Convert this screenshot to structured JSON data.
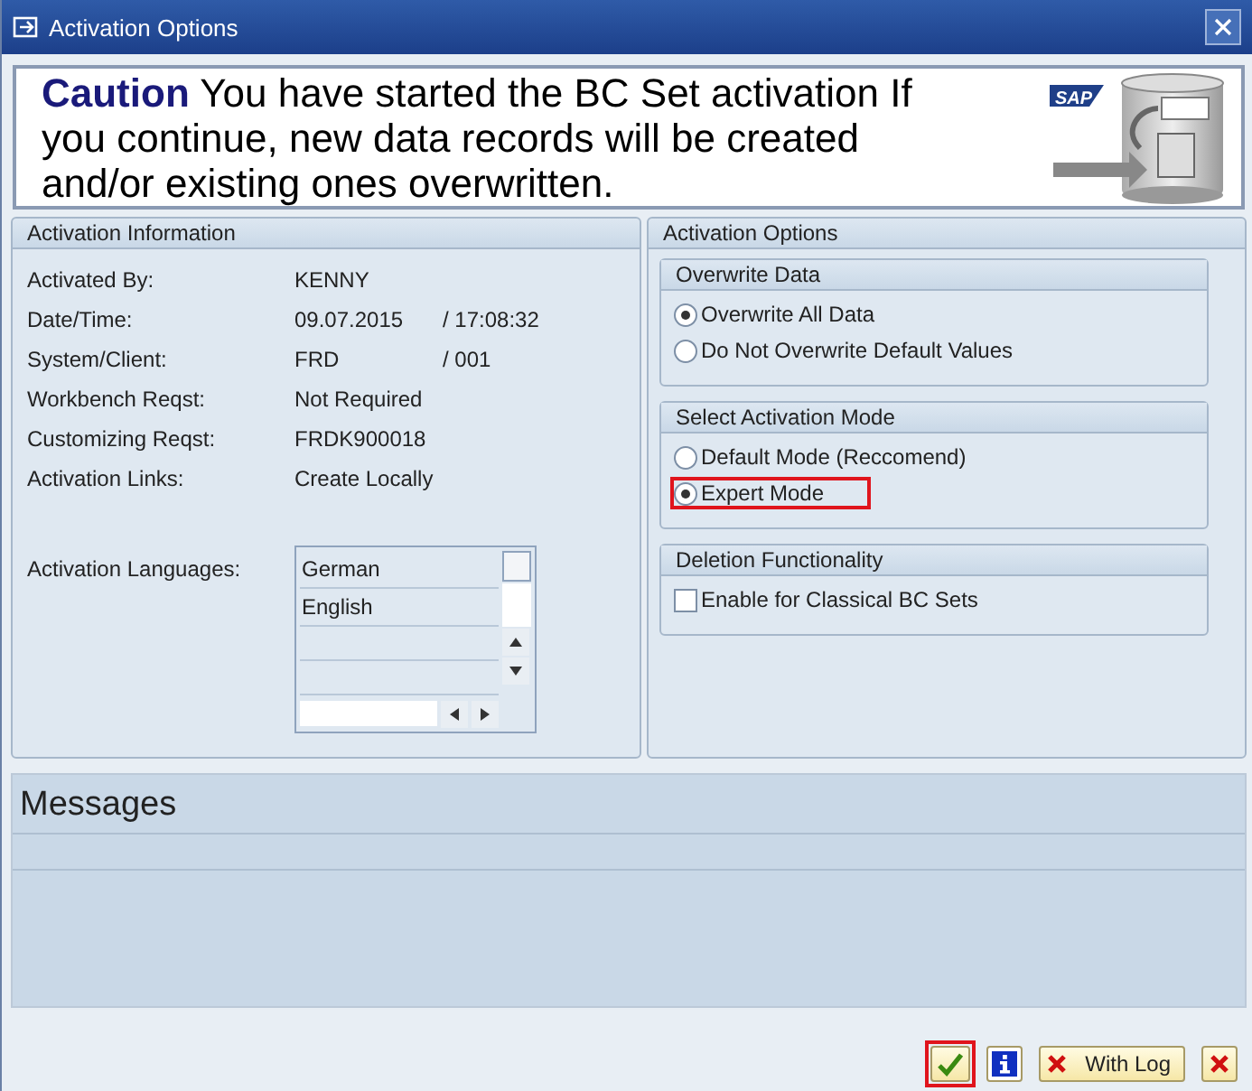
{
  "window": {
    "title": "Activation Options"
  },
  "banner": {
    "logo": "SAP",
    "text": "**Caution** You have started the BC Set activation If you continue, new data records will be created and/or existing ones overwritten."
  },
  "activation_information": {
    "title": "Activation Information",
    "rows": [
      {
        "label": "Activated By:",
        "value": "KENNY"
      },
      {
        "label": "Date/Time:",
        "value": "09.07.2015",
        "value_2": "/ 17:08:32"
      },
      {
        "label": "System/Client:",
        "value": "FRD",
        "value_2": "/ 001"
      },
      {
        "label": "Workbench Reqst:",
        "value": "Not Required"
      },
      {
        "label": "Customizing Reqst:",
        "value": "FRDK900018"
      },
      {
        "label": "Activation Links:",
        "value": "Create Locally"
      }
    ],
    "languages": {
      "label": "Activation Languages:",
      "items": [
        "German",
        "English"
      ]
    }
  },
  "activation_options": {
    "title": "Activation Options",
    "groups": [
      {
        "title": "Overwrite Data",
        "options": [
          {
            "kind": "radio",
            "label": "Overwrite All Data",
            "selected": true,
            "highlighted": false
          },
          {
            "kind": "radio",
            "label": "Do Not Overwrite Default Values",
            "selected": false,
            "highlighted": false
          }
        ]
      },
      {
        "title": "Select Activation Mode",
        "options": [
          {
            "kind": "radio",
            "label": "Default Mode (Reccomend)",
            "selected": false,
            "highlighted": false
          },
          {
            "kind": "radio",
            "label": "Expert Mode",
            "selected": true,
            "highlighted": true
          }
        ]
      },
      {
        "title": "Deletion Functionality",
        "options": [
          {
            "kind": "checkbox",
            "label": "Enable for Classical BC Sets",
            "checked": false,
            "highlighted": false
          }
        ]
      }
    ]
  },
  "messages": {
    "title": "Messages"
  },
  "buttons": [
    {
      "kind": "confirm",
      "highlighted": true
    },
    {
      "kind": "info",
      "highlighted": false
    },
    {
      "kind": "cancel",
      "label": "With Log",
      "highlighted": false
    },
    {
      "kind": "cancel",
      "highlighted": false
    }
  ]
}
